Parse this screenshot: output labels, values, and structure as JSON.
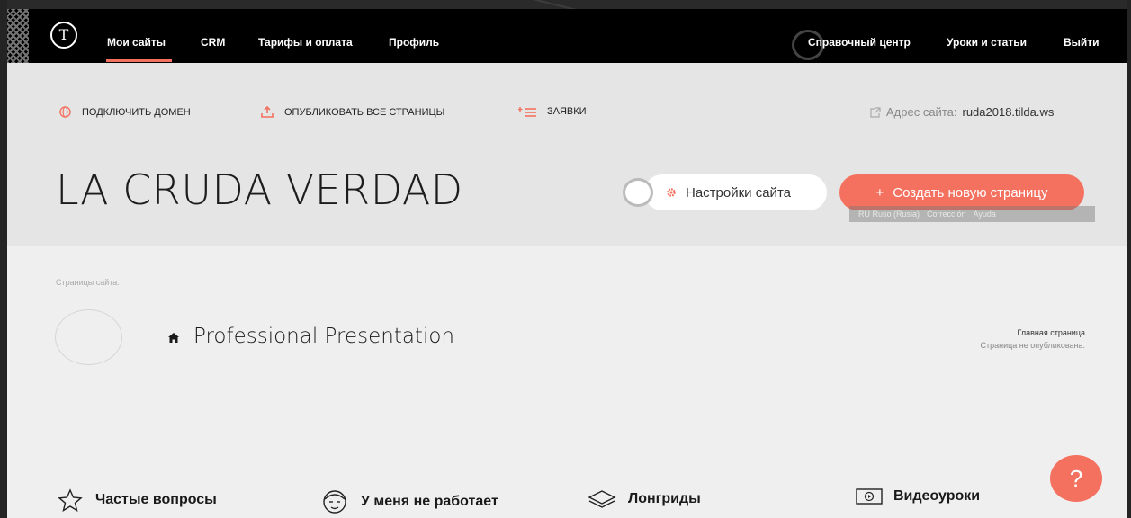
{
  "nav": {
    "logo": "T",
    "items": [
      {
        "label": "Мои сайты"
      },
      {
        "label": "CRM"
      },
      {
        "label": "Тарифы и оплата"
      },
      {
        "label": "Профиль"
      }
    ],
    "right_items": [
      {
        "label": "Справочный центр"
      },
      {
        "label": "Уроки и статьи"
      },
      {
        "label": "Выйти"
      }
    ],
    "active": "Мои сайты"
  },
  "actions": [
    {
      "label": "ПОДКЛЮЧИТЬ ДОМЕН",
      "icon": "globe-icon"
    },
    {
      "label": "ОПУБЛИКОВАТЬ ВСЕ СТРАНИЦЫ",
      "icon": "upload-icon"
    },
    {
      "label": "ЗАЯВКИ",
      "icon": "list-add-icon"
    }
  ],
  "site_address": {
    "label": "Адрес сайта:",
    "domain": "ruda2018.tilda.ws"
  },
  "site": {
    "title": "LA CRUDA VERDAD"
  },
  "buttons": {
    "settings": "Настройки сайта",
    "create": "Создать новую страницу"
  },
  "translate_bar": {
    "language": "RU Ruso (Rusia)",
    "correction": "Corrección",
    "help": "Ayuda"
  },
  "pages": {
    "section_label": "Страницы сайта:",
    "items": [
      {
        "title": "Professional Presentation",
        "badge": "Главная страница",
        "status": "Страница не опубликована."
      }
    ]
  },
  "footer": {
    "links": [
      {
        "label": "Частые вопросы",
        "icon": "star-icon"
      },
      {
        "label": "У меня не работает",
        "icon": "face-icon"
      },
      {
        "label": "Лонгриды",
        "icon": "layers-icon"
      },
      {
        "label": "Видеоуроки",
        "icon": "video-icon"
      }
    ],
    "chat_symbol": "?"
  },
  "colors": {
    "accent": "#f4705f",
    "nav_bg": "#000000",
    "header_bg": "#e5e5e5",
    "page_bg": "#efefef"
  }
}
